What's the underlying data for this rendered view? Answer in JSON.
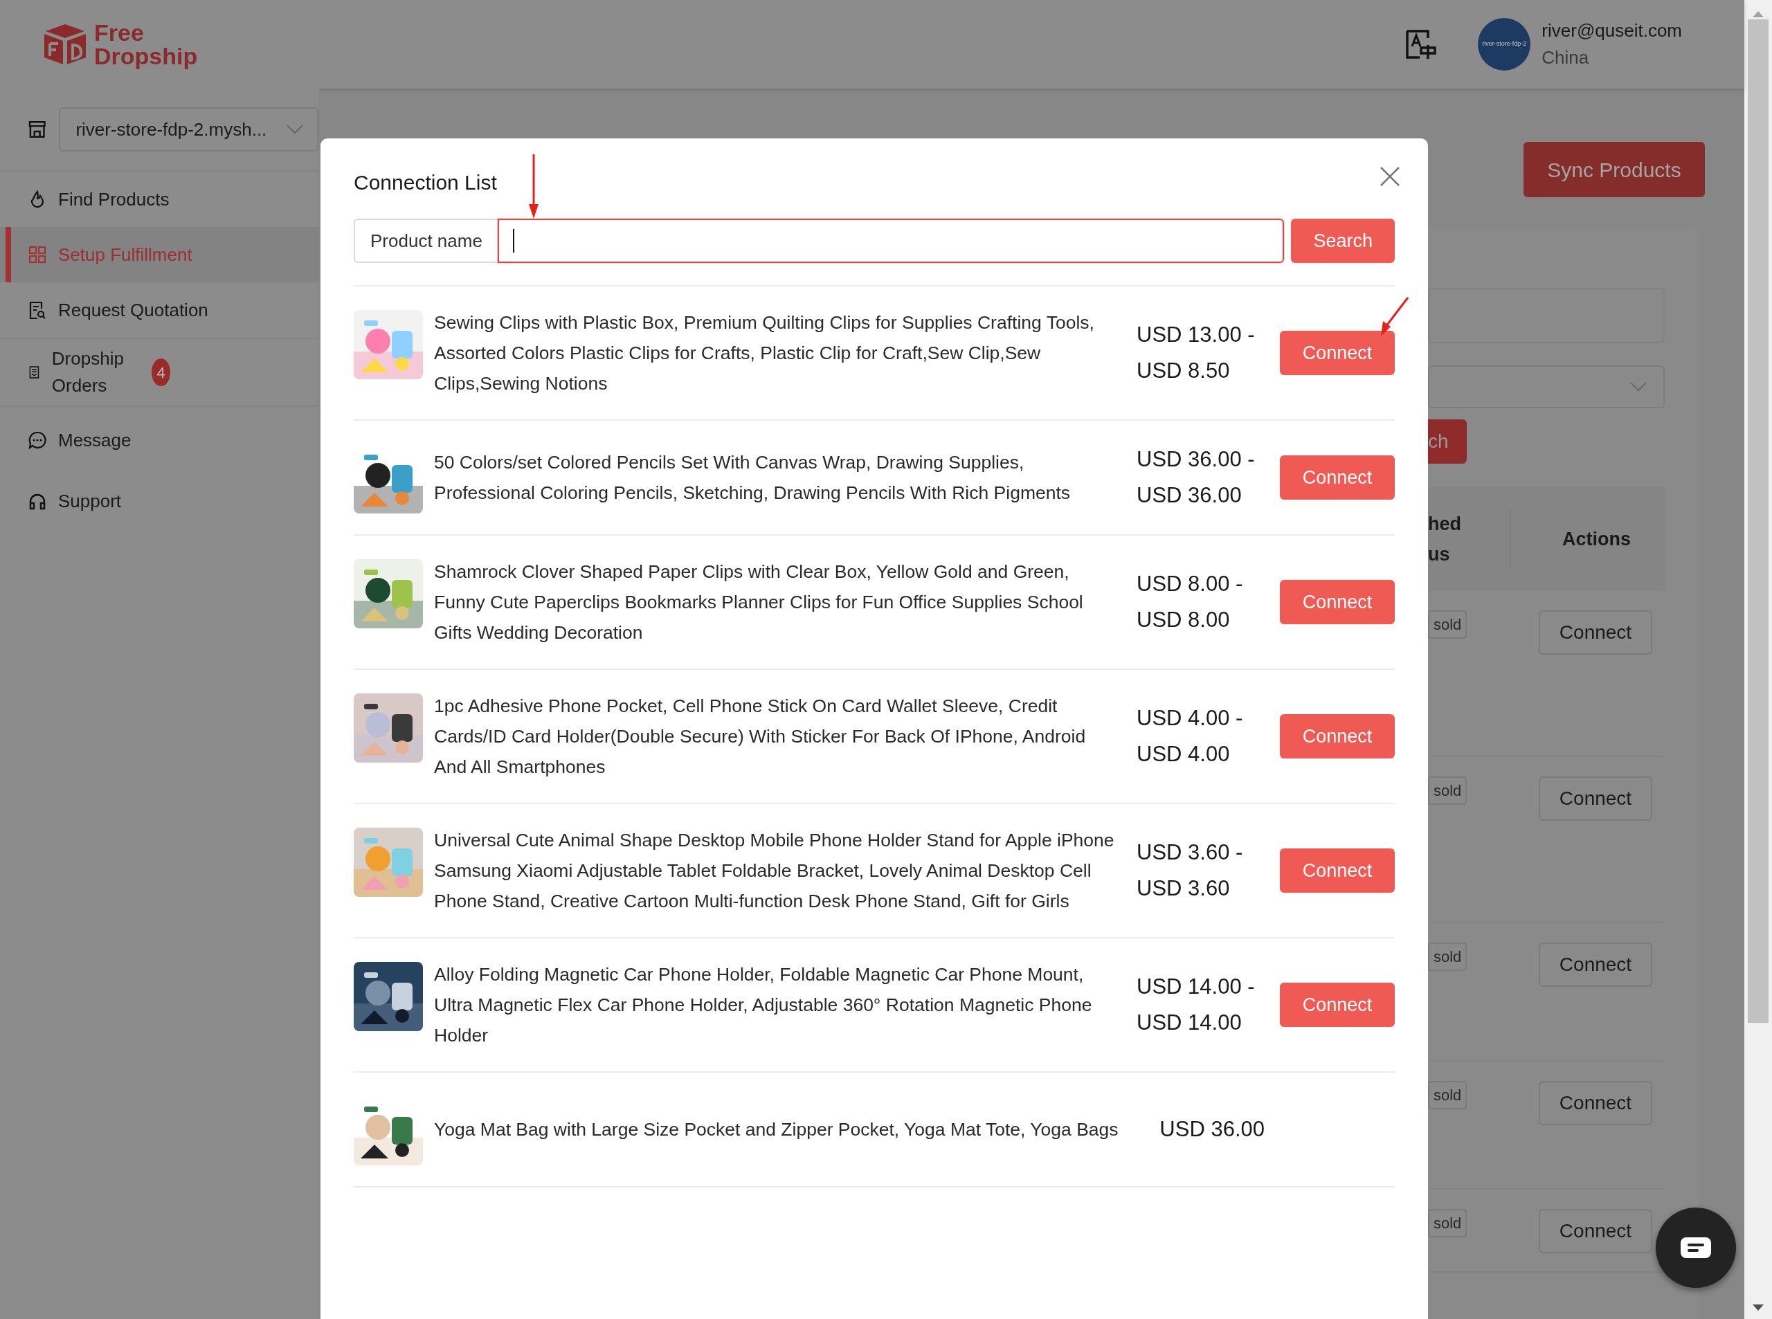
{
  "header": {
    "logo_top": "Free",
    "logo_bottom": "Dropship",
    "user": {
      "avatar_text": "river-store-fdp-2",
      "email": "river@quseit.com",
      "country": "China"
    }
  },
  "sidebar": {
    "store_select": "river-store-fdp-2.mysh...",
    "items": [
      {
        "label": "Find Products",
        "selected": false
      },
      {
        "label": "Setup Fulfillment",
        "selected": true
      },
      {
        "label": "Request Quotation",
        "selected": false
      },
      {
        "label": "Dropship Orders",
        "selected": false,
        "badge": "4"
      },
      {
        "label": "Message",
        "selected": false
      },
      {
        "label": "Support",
        "selected": false
      }
    ]
  },
  "background": {
    "sync_button": "Sync Products",
    "search_button_fragment": "ch",
    "status_header_lines": [
      "hed",
      "us"
    ],
    "actions_header": "Actions",
    "rows": [
      {
        "status": "sold",
        "action": "Connect"
      },
      {
        "status": "sold",
        "action": "Connect"
      },
      {
        "status": "sold",
        "action": "Connect"
      },
      {
        "status": "sold",
        "action": "Connect"
      },
      {
        "status": "sold",
        "action": "Connect"
      }
    ]
  },
  "modal": {
    "title": "Connection List",
    "search": {
      "addon": "Product name",
      "focused": true,
      "button": "Search"
    },
    "products": [
      {
        "name": "Sewing Clips with Plastic Box, Premium Quilting Clips for Supplies Crafting Tools, Assorted Colors Plastic Clips for Crafts, Plastic Clip for Craft,Sew Clip,Sew Clips,Sewing Notions",
        "price": "USD 13.00 - USD 8.50",
        "button": "Connect"
      },
      {
        "name": "50 Colors/set Colored Pencils Set With Canvas Wrap, Drawing Supplies, Professional Coloring Pencils, Sketching, Drawing Pencils With Rich Pigments",
        "price": "USD 36.00 - USD 36.00",
        "button": "Connect"
      },
      {
        "name": "Shamrock Clover Shaped Paper Clips with Clear Box, Yellow Gold and Green, Funny Cute Paperclips Bookmarks Planner Clips for Fun Office Supplies School Gifts Wedding Decoration",
        "price": "USD 8.00 - USD 8.00",
        "button": "Connect"
      },
      {
        "name": "1pc Adhesive Phone Pocket, Cell Phone Stick On Card Wallet Sleeve, Credit Cards/ID Card Holder(Double Secure) With Sticker For Back Of IPhone, Android And All Smartphones",
        "price": "USD 4.00 - USD 4.00",
        "button": "Connect"
      },
      {
        "name": "Universal Cute Animal Shape Desktop Mobile Phone Holder Stand for Apple iPhone Samsung Xiaomi Adjustable Tablet Foldable Bracket, Lovely Animal Desktop Cell Phone Stand, Creative Cartoon Multi-function Desk Phone Stand, Gift for Girls",
        "price": "USD 3.60 - USD 3.60",
        "button": "Connect"
      },
      {
        "name": "Alloy Folding Magnetic Car Phone Holder, Foldable Magnetic Car Phone Mount, Ultra Magnetic Flex Car Phone Holder, Adjustable 360° Rotation Magnetic Phone Holder",
        "price": "USD 14.00 - USD 14.00",
        "button": "Connect"
      },
      {
        "name": "Yoga Mat Bag with Large Size Pocket and Zipper Pocket, Yoga Mat Tote, Yoga Bags",
        "price": "USD 36.00"
      }
    ]
  }
}
